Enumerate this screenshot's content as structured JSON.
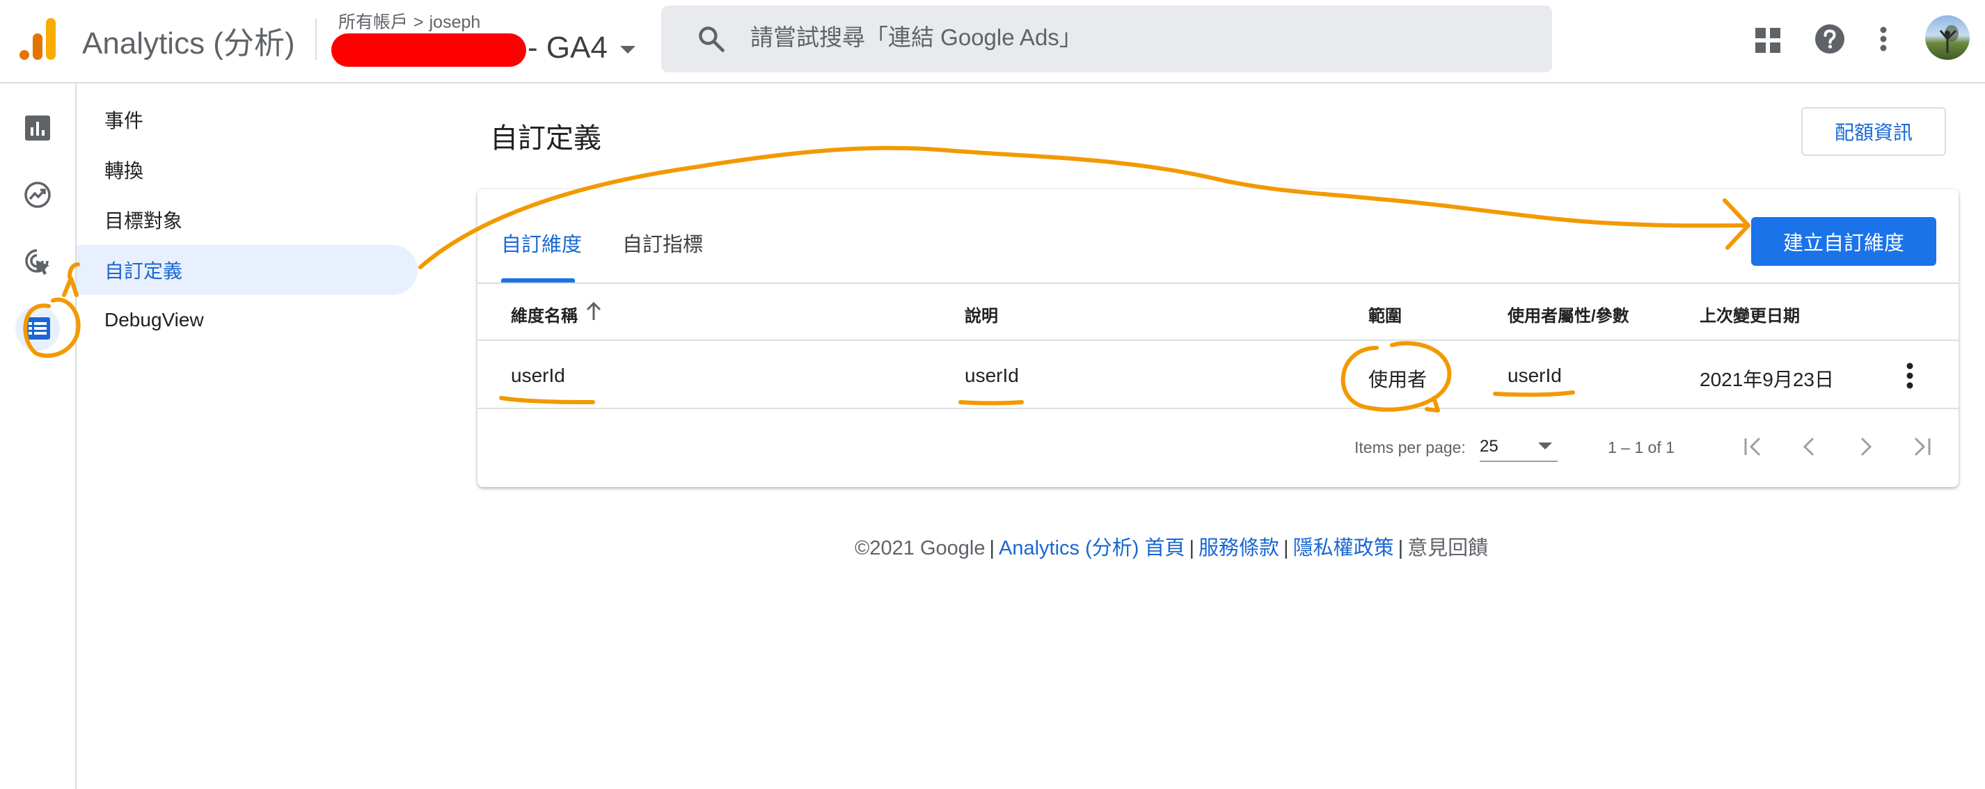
{
  "header": {
    "app_title": "Analytics (分析)",
    "breadcrumb_root": "所有帳戶",
    "breadcrumb_separator": ">",
    "breadcrumb_account": "joseph",
    "property_name": "- GA4",
    "search_placeholder": "請嘗試搜尋「連結 Google Ads」",
    "icons": [
      "search-icon",
      "apps-grid-icon",
      "help-icon",
      "more-vert-icon"
    ]
  },
  "rail": {
    "items": [
      "reports-icon",
      "explore-icon",
      "advertising-icon",
      "configure-icon"
    ],
    "active": "configure-icon"
  },
  "subnav": {
    "items": [
      {
        "label": "事件"
      },
      {
        "label": "轉換"
      },
      {
        "label": "目標對象"
      },
      {
        "label": "自訂定義",
        "active": true
      },
      {
        "label": "DebugView"
      }
    ]
  },
  "main": {
    "title": "自訂定義",
    "quota_button": "配額資訊",
    "tabs": [
      {
        "label": "自訂維度",
        "active": true
      },
      {
        "label": "自訂指標"
      }
    ],
    "create_button": "建立自訂維度",
    "table": {
      "columns": [
        "維度名稱",
        "說明",
        "範圍",
        "使用者屬性/參數",
        "上次變更日期"
      ],
      "sorted_column": "維度名稱",
      "rows": [
        [
          "userId",
          "userId",
          "使用者",
          "userId",
          "2021年9月23日"
        ]
      ]
    },
    "pagination": {
      "items_per_page_label": "Items per page:",
      "items_per_page": "25",
      "range": "1 – 1 of 1"
    }
  },
  "footer": {
    "copyright": "©2021 Google",
    "separator": "|",
    "links": [
      "Analytics (分析) 首頁",
      "服務條款",
      "隱私權政策"
    ],
    "feedback": "意見回饋"
  },
  "colors": {
    "accent": "#1a73e8",
    "link": "#1967d2",
    "annotation": "#f29900",
    "redaction": "#ff0000",
    "active_bg": "#e8f0fe"
  }
}
